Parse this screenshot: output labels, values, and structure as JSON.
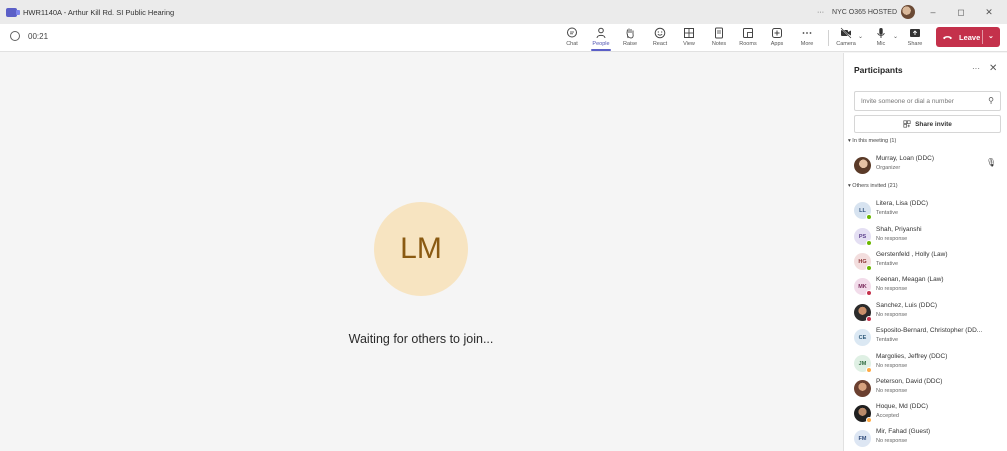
{
  "window": {
    "title": "HWR1140A - Arthur Kill Rd. SI Public Hearing",
    "org_label": "NYC O365 HOSTED",
    "more": "···",
    "minimize": "–",
    "restore": "◻",
    "close": "✕"
  },
  "toolbar": {
    "timer": "00:21",
    "buttons": [
      {
        "label": "Chat",
        "icon": "chat-icon"
      },
      {
        "label": "People",
        "icon": "people-icon",
        "active": true
      },
      {
        "label": "Raise",
        "icon": "hand-icon"
      },
      {
        "label": "React",
        "icon": "smile-icon"
      },
      {
        "label": "View",
        "icon": "grid-icon"
      },
      {
        "label": "Notes",
        "icon": "notes-icon"
      },
      {
        "label": "Rooms",
        "icon": "rooms-icon"
      },
      {
        "label": "Apps",
        "icon": "plus-icon"
      },
      {
        "label": "More",
        "icon": "more-icon"
      },
      {
        "label": "Camera",
        "icon": "camera-off-icon"
      },
      {
        "label": "Mic",
        "icon": "mic-icon"
      },
      {
        "label": "Share",
        "icon": "share-icon"
      }
    ],
    "leave_label": "Leave",
    "accent_color": "#c4314b"
  },
  "stage": {
    "avatar_initials": "LM",
    "avatar_bg": "#f7e4c1",
    "waiting_text": "Waiting for others to join..."
  },
  "panel": {
    "title": "Participants",
    "more": "···",
    "close": "✕",
    "invite_placeholder": "Invite someone or dial a number",
    "share_invite": "Share invite",
    "in_meeting_header": "In this meeting (1)",
    "others_header": "Others invited (21)",
    "in_meeting": [
      {
        "name": "Murray, Loan (DDC)",
        "role": "Organizer"
      }
    ],
    "others": [
      {
        "initials": "LL",
        "name": "Litera, Lisa (DDC)",
        "status": "Tentative",
        "bg": "#d7e3f0",
        "fg": "#2e4f7a",
        "dot": "#6bb700"
      },
      {
        "initials": "PS",
        "name": "Shah, Priyanshi",
        "status": "No response",
        "bg": "#e4dff3",
        "fg": "#5b3f8c",
        "dot": "#6bb700"
      },
      {
        "initials": "HG",
        "name": "Gerstenfeld , Holly (Law)",
        "status": "Tentative",
        "bg": "#f3dede",
        "fg": "#8a2f2f",
        "dot": "#6bb700"
      },
      {
        "initials": "MK",
        "name": "Keenan, Meagan (Law)",
        "status": "No response",
        "bg": "#f2dcea",
        "fg": "#7a2a5c",
        "dot": "#c4314b"
      },
      {
        "initials": "",
        "name": "Sanchez, Luis (DDC)",
        "status": "No response",
        "photo": true,
        "dot": "#c4314b"
      },
      {
        "initials": "CE",
        "name": "Esposito-Bernard, Christopher (DD...",
        "status": "Tentative",
        "bg": "#dbe8f3",
        "fg": "#2e5a7a",
        "dot": ""
      },
      {
        "initials": "JM",
        "name": "Margolies, Jeffrey (DDC)",
        "status": "No response",
        "bg": "#dff0e4",
        "fg": "#2e6b3f",
        "dot": "#ffaa44"
      },
      {
        "initials": "",
        "name": "Peterson, David (DDC)",
        "status": "No response",
        "photo": true,
        "dot": ""
      },
      {
        "initials": "",
        "name": "Hoque, Md (DDC)",
        "status": "Accepted",
        "photo": true,
        "dot": "#ffaa44"
      },
      {
        "initials": "FM",
        "name": "Mir, Fahad (Guest)",
        "status": "No response",
        "bg": "#dde6f3",
        "fg": "#2e4a7a",
        "dot": ""
      }
    ]
  }
}
